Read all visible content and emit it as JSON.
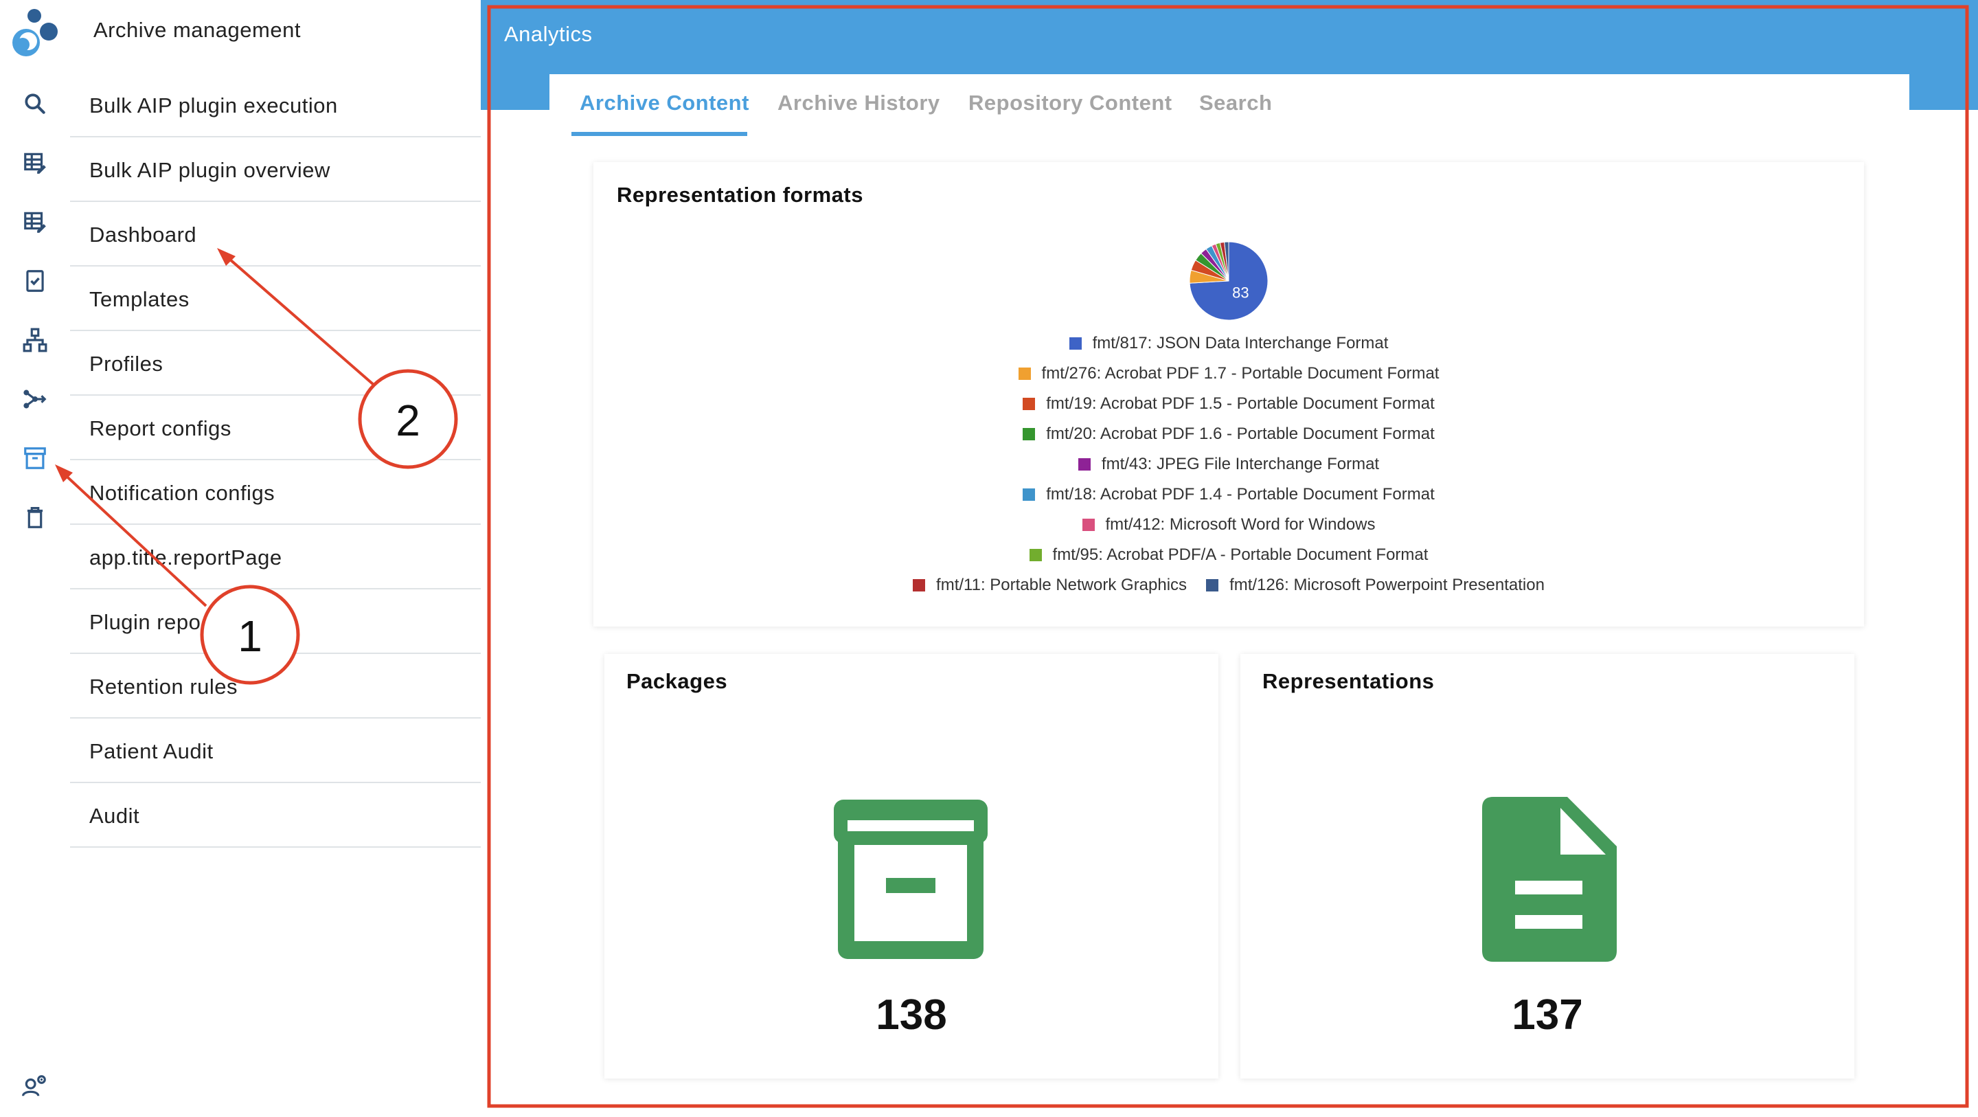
{
  "sidebar": {
    "title": "Archive management",
    "items": [
      {
        "label": "Bulk AIP plugin execution"
      },
      {
        "label": "Bulk AIP plugin overview"
      },
      {
        "label": "Dashboard"
      },
      {
        "label": "Templates"
      },
      {
        "label": "Profiles"
      },
      {
        "label": "Report configs"
      },
      {
        "label": "Notification configs"
      },
      {
        "label": "app.title.reportPage"
      },
      {
        "label": "Plugin repo"
      },
      {
        "label": "Retention rules"
      },
      {
        "label": "Patient Audit"
      },
      {
        "label": "Audit"
      }
    ],
    "rail_icons": [
      "search-icon",
      "table-edit-icon",
      "table-edit-icon",
      "checklist-icon",
      "sitemap-icon",
      "share-icon",
      "archive-icon",
      "trash-icon",
      "user-settings-icon"
    ]
  },
  "header": {
    "title": "Analytics",
    "color": "#4a9fdd"
  },
  "tabs": [
    {
      "label": "Archive Content",
      "active": true
    },
    {
      "label": "Archive History",
      "active": false
    },
    {
      "label": "Repository Content",
      "active": false
    },
    {
      "label": "Search",
      "active": false
    }
  ],
  "formats_card": {
    "title": "Representation formats"
  },
  "chart_data": {
    "type": "pie",
    "slices": [
      {
        "label": "fmt/817: JSON Data Interchange Format",
        "value": 83,
        "color": "#3e63c6"
      },
      {
        "label": "fmt/276: Acrobat PDF 1.7 - Portable Document Format",
        "value": 6,
        "color": "#f0a030"
      },
      {
        "label": "fmt/19: Acrobat PDF 1.5 - Portable Document Format",
        "value": 5,
        "color": "#d24a22"
      },
      {
        "label": "fmt/20: Acrobat PDF 1.6 - Portable Document Format",
        "value": 4,
        "color": "#35962f"
      },
      {
        "label": "fmt/43: JPEG File Interchange Format",
        "value": 3,
        "color": "#8e2296"
      },
      {
        "label": "fmt/18: Acrobat PDF 1.4 - Portable Document Format",
        "value": 3,
        "color": "#3f94cb"
      },
      {
        "label": "fmt/412: Microsoft Word for Windows",
        "value": 2,
        "color": "#d9507e"
      },
      {
        "label": "fmt/95: Acrobat PDF/A - Portable Document Format",
        "value": 2,
        "color": "#72ad2e"
      },
      {
        "label": "fmt/11: Portable Network Graphics",
        "value": 2,
        "color": "#b42f2f"
      },
      {
        "label": "fmt/126: Microsoft Powerpoint Presentation",
        "value": 2,
        "color": "#3a5a8c"
      }
    ],
    "data_labels": [
      "83"
    ]
  },
  "packages_card": {
    "title": "Packages",
    "value": "138",
    "icon": "archive-box-icon",
    "color": "#459a5a"
  },
  "representations_card": {
    "title": "Representations",
    "value": "137",
    "icon": "document-icon",
    "color": "#459a5a"
  },
  "annotations": [
    {
      "label": "1"
    },
    {
      "label": "2"
    }
  ],
  "annotation_color": "#e0412a"
}
